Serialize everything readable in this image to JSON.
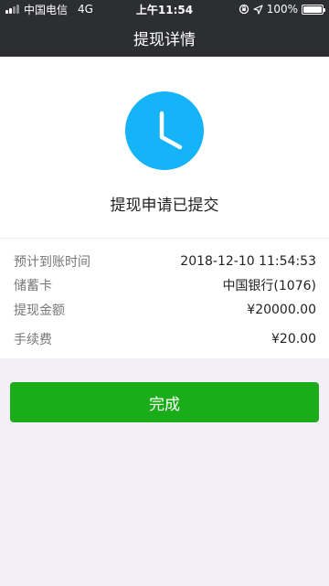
{
  "status_bar": {
    "carrier": "中国电信",
    "network": "4G",
    "time": "上午11:54",
    "battery_text": "100%",
    "battery_level": 1.0
  },
  "nav": {
    "title": "提现详情"
  },
  "hero": {
    "icon": "clock-icon",
    "icon_color": "#15b3f8",
    "message": "提现申请已提交"
  },
  "details": [
    {
      "label": "预计到账时间",
      "value": "2018-12-10 11:54:53"
    },
    {
      "label": "储蓄卡",
      "value": "中国银行(1076)"
    },
    {
      "label": "提现金额",
      "value": "¥20000.00"
    },
    {
      "label": "手续费",
      "value": "¥20.00"
    }
  ],
  "actions": {
    "done_label": "完成",
    "done_color": "#1aad19"
  }
}
